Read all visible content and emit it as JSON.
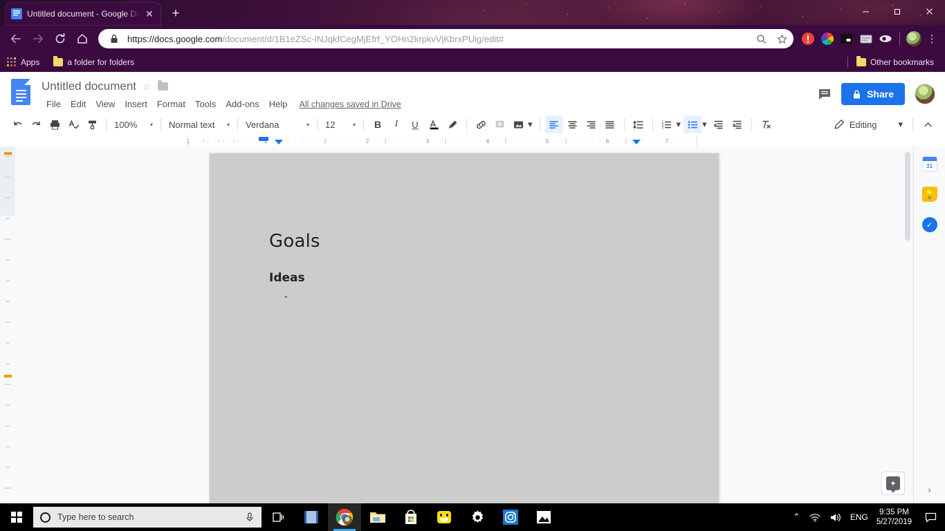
{
  "browser": {
    "tab": {
      "title": "Untitled document - Google Doc",
      "close_label": "✕",
      "favicon": "google-docs-favicon"
    },
    "new_tab_label": "+",
    "window_controls": {
      "minimize": "—",
      "maximize": "❐",
      "close": "✕"
    },
    "nav": {
      "back": "←",
      "forward": "→",
      "reload": "⟳",
      "home": "⌂"
    },
    "omnibox": {
      "lock_icon": "lock-icon",
      "url_prefix": "https://docs.google.com",
      "url_path": "/document/d/1B1eZSc-INJqkfCegMjEfrf_YOHn2krpkvVjKbrxPUig/edit#",
      "full_url": "https://docs.google.com/document/d/1B1eZSc-INJqkfCegMjEfrf_YOHn2krpkvVjKbrxPUig/edit#",
      "zoom_icon": "search-zoom-icon",
      "bookmark_star": "☆"
    },
    "extensions": [
      {
        "name": "alert-extension-icon",
        "color": "#ea4335"
      },
      {
        "name": "color-wheel-extension-icon",
        "color": "#34a853"
      },
      {
        "name": "screen-capture-extension-icon",
        "color": "#000000"
      },
      {
        "name": "keyboard-extension-icon",
        "color": "#9aa0a6"
      },
      {
        "name": "eye-extension-icon",
        "color": "#dadce0"
      }
    ],
    "menu_label": "⋮",
    "bookmarks": {
      "apps_label": "Apps",
      "items": [
        {
          "label": "a folder for folders",
          "icon": "folder-icon"
        }
      ],
      "other_label": "Other bookmarks"
    }
  },
  "docs": {
    "title": "Untitled document",
    "star_icon": "☆",
    "move_icon": "move-to-folder-icon",
    "menus": [
      "File",
      "Edit",
      "View",
      "Insert",
      "Format",
      "Tools",
      "Add-ons",
      "Help"
    ],
    "save_status": "All changes saved in Drive",
    "comment_icon": "comment-icon",
    "share": {
      "label": "Share",
      "lock_icon": "lock-icon"
    },
    "avatar": "user-avatar",
    "toolbar": {
      "undo": "↶",
      "redo": "↷",
      "print": "print-icon",
      "spelling": "spellcheck-icon",
      "paint_format": "paint-format-icon",
      "zoom": "100%",
      "style": "Normal text",
      "font": "Verdana",
      "font_size": "12",
      "bold": "B",
      "italic": "I",
      "underline": "U",
      "text_color": "A",
      "highlight": "highlight-icon",
      "link": "link-icon",
      "comment_add": "add-comment-icon",
      "image": "insert-image-icon",
      "align_left": "align-left-icon",
      "align_center": "align-center-icon",
      "align_right": "align-right-icon",
      "align_justify": "align-justify-icon",
      "line_spacing": "line-spacing-icon",
      "numbered_list": "numbered-list-icon",
      "bulleted_list": "bulleted-list-icon",
      "decrease_indent": "decrease-indent-icon",
      "increase_indent": "increase-indent-icon",
      "clear_formatting": "clear-formatting-icon",
      "mode_label": "Editing",
      "mode_icon": "pencil-icon",
      "collapse": "⌃",
      "caret": "▾"
    },
    "ruler": {
      "marks": [
        "1",
        "1",
        "2",
        "3",
        "4",
        "5",
        "6",
        "7"
      ]
    },
    "document": {
      "heading": "Goals",
      "subheading": "Ideas",
      "bullet": "-"
    },
    "sidebar": [
      {
        "name": "google-calendar-icon",
        "label": "31"
      },
      {
        "name": "google-keep-icon",
        "label": ""
      },
      {
        "name": "google-tasks-icon",
        "label": ""
      }
    ],
    "sidebar_expand": "›",
    "explore_label": "explore-icon"
  },
  "taskbar": {
    "start": "windows-start-icon",
    "search_placeholder": "Type here to search",
    "mic_icon": "microphone-icon",
    "items": [
      {
        "name": "task-view-icon"
      },
      {
        "name": "movie-maker-icon"
      },
      {
        "name": "google-chrome-icon"
      },
      {
        "name": "file-explorer-icon"
      },
      {
        "name": "microsoft-store-icon"
      },
      {
        "name": "smiley-app-icon"
      },
      {
        "name": "settings-gear-icon"
      },
      {
        "name": "instagram-icon"
      },
      {
        "name": "photos-icon"
      }
    ],
    "tray": {
      "chevron": "⌃",
      "network_icon": "wifi-icon",
      "volume_icon": "volume-icon",
      "language": "ENG",
      "time": "9:35 PM",
      "date": "5/27/2019",
      "action_center": "notifications-icon"
    }
  }
}
